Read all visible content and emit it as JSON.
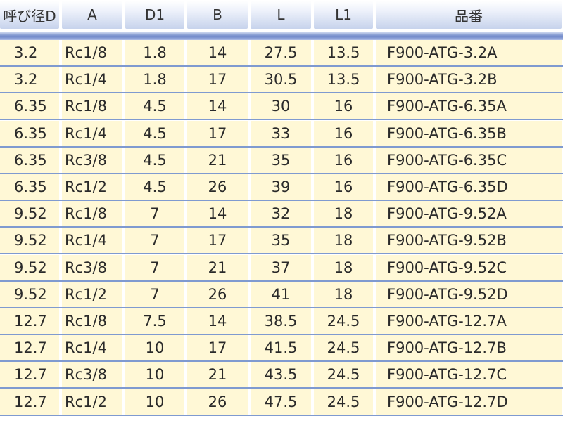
{
  "headers": [
    "呼び径D",
    "A",
    "D1",
    "B",
    "L",
    "L1",
    "品番"
  ],
  "rows": [
    [
      "3.2",
      "Rc1/8",
      "1.8",
      "14",
      "27.5",
      "13.5",
      "F900-ATG-3.2A"
    ],
    [
      "3.2",
      "Rc1/4",
      "1.8",
      "17",
      "30.5",
      "13.5",
      "F900-ATG-3.2B"
    ],
    [
      "6.35",
      "Rc1/8",
      "4.5",
      "14",
      "30",
      "16",
      "F900-ATG-6.35A"
    ],
    [
      "6.35",
      "Rc1/4",
      "4.5",
      "17",
      "33",
      "16",
      "F900-ATG-6.35B"
    ],
    [
      "6.35",
      "Rc3/8",
      "4.5",
      "21",
      "35",
      "16",
      "F900-ATG-6.35C"
    ],
    [
      "6.35",
      "Rc1/2",
      "4.5",
      "26",
      "39",
      "16",
      "F900-ATG-6.35D"
    ],
    [
      "9.52",
      "Rc1/8",
      "7",
      "14",
      "32",
      "18",
      "F900-ATG-9.52A"
    ],
    [
      "9.52",
      "Rc1/4",
      "7",
      "17",
      "35",
      "18",
      "F900-ATG-9.52B"
    ],
    [
      "9.52",
      "Rc3/8",
      "7",
      "21",
      "37",
      "18",
      "F900-ATG-9.52C"
    ],
    [
      "9.52",
      "Rc1/2",
      "7",
      "26",
      "41",
      "18",
      "F900-ATG-9.52D"
    ],
    [
      "12.7",
      "Rc1/8",
      "7.5",
      "14",
      "38.5",
      "24.5",
      "F900-ATG-12.7A"
    ],
    [
      "12.7",
      "Rc1/4",
      "10",
      "17",
      "41.5",
      "24.5",
      "F900-ATG-12.7B"
    ],
    [
      "12.7",
      "Rc3/8",
      "10",
      "21",
      "43.5",
      "24.5",
      "F900-ATG-12.7C"
    ],
    [
      "12.7",
      "Rc1/2",
      "10",
      "26",
      "47.5",
      "24.5",
      "F900-ATG-12.7D"
    ]
  ],
  "colors": {
    "row_fill": "#fff8d6",
    "separator": "#7f9ad0",
    "header_bar": "#6f87c9"
  }
}
